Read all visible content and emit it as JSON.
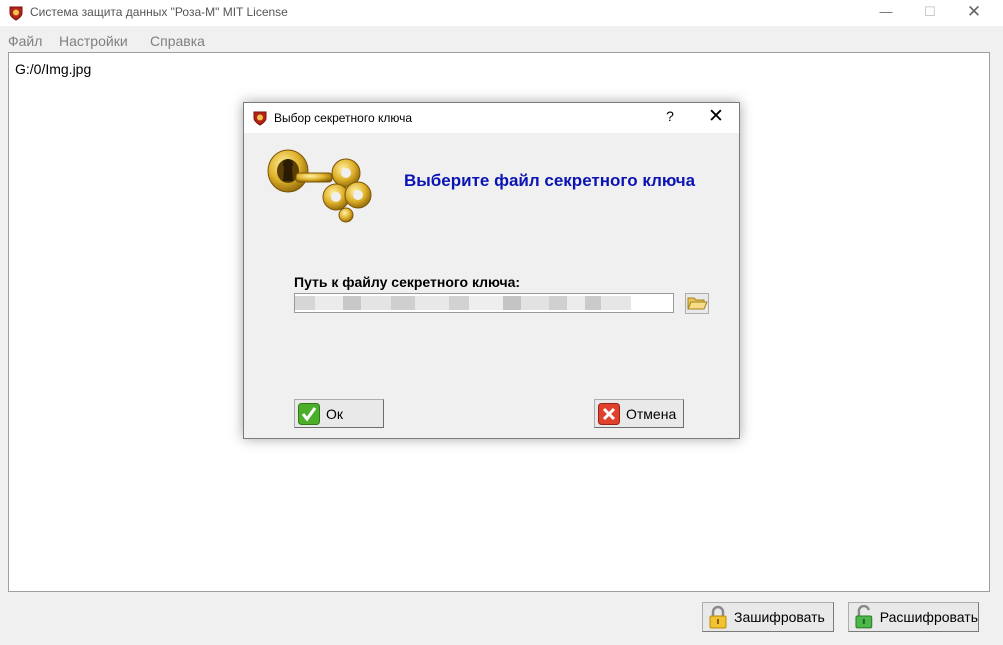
{
  "window": {
    "title": "Система защита данных \"Роза-М\" MIT License",
    "minimize_glyph": "—",
    "maximize_glyph": "☐",
    "close_glyph": "✕"
  },
  "menu": {
    "items": [
      "Файл",
      "Настройки",
      "Справка"
    ]
  },
  "editor": {
    "text": "G:/0/Img.jpg"
  },
  "toolbar": {
    "encrypt_label": "Зашифровать",
    "decrypt_label": "Расшифровать"
  },
  "dialog": {
    "title": "Выбор секретного ключа",
    "help_glyph": "?",
    "close_glyph": "✕",
    "heading": "Выберите файл секретного ключа",
    "path_label": "Путь к файлу секретного ключа:",
    "path_value": "",
    "ok_label": "Ок",
    "cancel_label": "Отмена"
  },
  "icons": {
    "app": "rose-shield-icon",
    "key_art": "golden-key-keyhole-icon",
    "browse": "folder-open-icon",
    "ok": "checkmark-icon",
    "cancel": "cross-icon",
    "encrypt": "locked-padlock-icon",
    "decrypt": "unlocked-padlock-icon"
  },
  "colors": {
    "heading": "#0a14b4",
    "ok_icon": "#4caf2a",
    "cancel_icon": "#e0412c",
    "key_gold": "#d9a81c"
  }
}
